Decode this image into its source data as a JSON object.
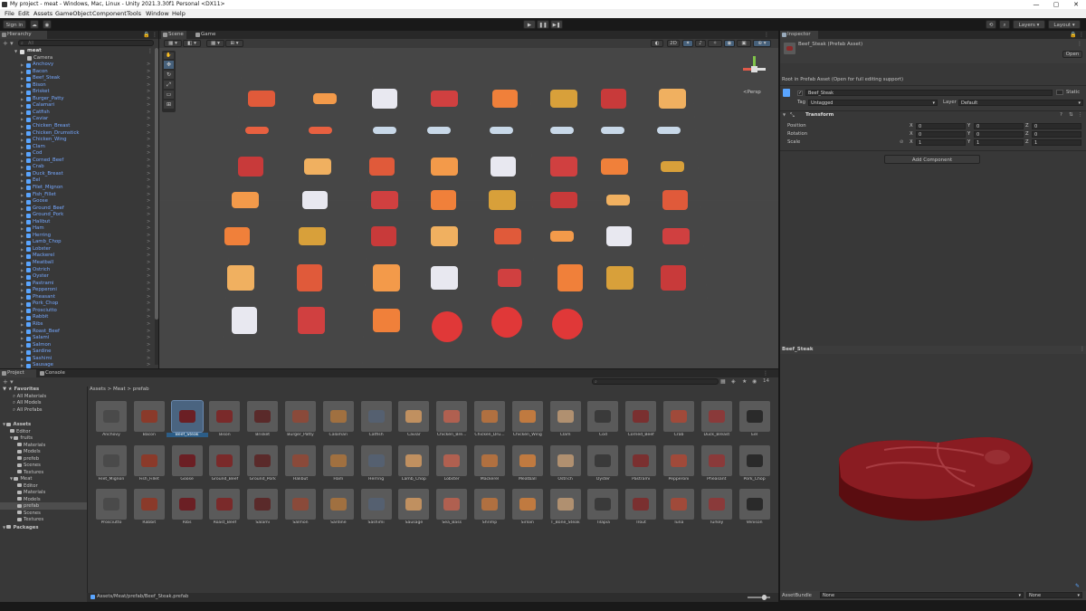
{
  "window": {
    "title": "My project - meat - Windows, Mac, Linux - Unity 2021.3.30f1 Personal <DX11>",
    "min": "—",
    "max": "▢",
    "close": "✕"
  },
  "menu": [
    "File",
    "Edit",
    "Assets",
    "GameObject",
    "Component",
    "Tools",
    "Window",
    "Help"
  ],
  "toolbar": {
    "signin": "Sign in",
    "layers": "Layers",
    "layout": "Layout",
    "play": "▶",
    "pause": "❚❚",
    "step": "▶❚"
  },
  "hierarchy": {
    "tab": "Hierarchy",
    "search_placeholder": "All",
    "scene": "meat",
    "items": [
      "Camera",
      "Anchovy",
      "Bacon",
      "Beef_Steak",
      "Bison",
      "Brisket",
      "Burger_Patty",
      "Calamari",
      "Catfish",
      "Caviar",
      "Chicken_Breast",
      "Chicken_Drumstick",
      "Chicken_Wing",
      "Clam",
      "Cod",
      "Corned_Beef",
      "Crab",
      "Duck_Breast",
      "Eel",
      "Filet_Mignon",
      "Fish_Fillet",
      "Goose",
      "Ground_Beef",
      "Ground_Pork",
      "Halibut",
      "Ham",
      "Herring",
      "Lamb_Chop",
      "Lobster",
      "Mackerel",
      "Meatball",
      "Ostrich",
      "Oyster",
      "Pastrami",
      "Pepperoni",
      "Pheasant",
      "Pork_Chop",
      "Prosciutto",
      "Rabbit",
      "Ribs",
      "Roast_Beef",
      "Salami",
      "Salmon",
      "Sardine",
      "Sashimi",
      "Sausage"
    ]
  },
  "scene": {
    "tab_scene": "Scene",
    "tab_game": "Game",
    "persp": "<Persp",
    "mode_2d": "2D"
  },
  "project": {
    "tab_project": "Project",
    "tab_console": "Console",
    "breadcrumb": [
      "Assets",
      "Meat",
      "prefab"
    ],
    "count": "14",
    "path": "Assets/Meat/prefab/Beef_Steak.prefab",
    "favorites": {
      "label": "Favorites",
      "items": [
        "All Materials",
        "All Models",
        "All Prefabs"
      ]
    },
    "tree": [
      {
        "label": "Assets",
        "depth": 0
      },
      {
        "label": "Editor",
        "depth": 1
      },
      {
        "label": "fruits",
        "depth": 1
      },
      {
        "label": "Materials",
        "depth": 2
      },
      {
        "label": "Models",
        "depth": 2
      },
      {
        "label": "prefeb",
        "depth": 2
      },
      {
        "label": "Scenes",
        "depth": 2
      },
      {
        "label": "Textures",
        "depth": 2
      },
      {
        "label": "Meat",
        "depth": 1
      },
      {
        "label": "Editor",
        "depth": 2
      },
      {
        "label": "Materials",
        "depth": 2
      },
      {
        "label": "Models",
        "depth": 2
      },
      {
        "label": "prefab",
        "depth": 2
      },
      {
        "label": "Scenes",
        "depth": 2
      },
      {
        "label": "Textures",
        "depth": 2
      },
      {
        "label": "Packages",
        "depth": 0
      }
    ],
    "assets": [
      "Anchovy",
      "Bacon",
      "Beef_Steak",
      "Bison",
      "Brisket",
      "Burger_Patty",
      "Calamari",
      "Catfish",
      "Caviar",
      "Chicken_Bre...",
      "Chicken_Dru...",
      "Chicken_Wing",
      "Clam",
      "Cod",
      "Corned_Beef",
      "Crab",
      "Duck_Breast",
      "Eel",
      "Filet_Mignon",
      "Fish_Fillet",
      "Goose",
      "Ground_Beef",
      "Ground_Pork",
      "Halibut",
      "Ham",
      "Herring",
      "Lamb_Chop",
      "Lobster",
      "Mackerel",
      "Meatball",
      "Ostrich",
      "Oyster",
      "Pastrami",
      "Pepperoni",
      "Pheasant",
      "Pork_Chop",
      "Prosciutto",
      "Rabbit",
      "Ribs",
      "Roast_Beef",
      "Salami",
      "Salmon",
      "Sardine",
      "Sashimi",
      "Sausage",
      "Sea_Bass",
      "Shrimp",
      "Sirloin",
      "T_Bone_Steak",
      "Tilapia",
      "Trout",
      "Tuna",
      "Turkey",
      "Venison"
    ],
    "selected": "Beef_Steak"
  },
  "inspector": {
    "tab": "Inspector",
    "asset_title": "Beef_Steak (Prefab Asset)",
    "open": "Open",
    "root_note": "Root in Prefab Asset (Open for full editing support)",
    "name": "Beef_Steak",
    "static": "Static",
    "tag_label": "Tag",
    "tag_value": "Untagged",
    "layer_label": "Layer",
    "layer_value": "Default",
    "transform": "Transform",
    "position": "Position",
    "rotation": "Rotation",
    "scale": "Scale",
    "pos": [
      "0",
      "0",
      "0"
    ],
    "rot": [
      "0",
      "0",
      "0"
    ],
    "scl": [
      "1",
      "1",
      "1"
    ],
    "add_component": "Add Component",
    "preview_title": "Beef_Steak",
    "assetbundle_label": "AssetBundle",
    "assetbundle_value": "None",
    "variant_value": "None"
  },
  "colors": {
    "accent": "#2c5d87",
    "link": "#76a8ff"
  }
}
